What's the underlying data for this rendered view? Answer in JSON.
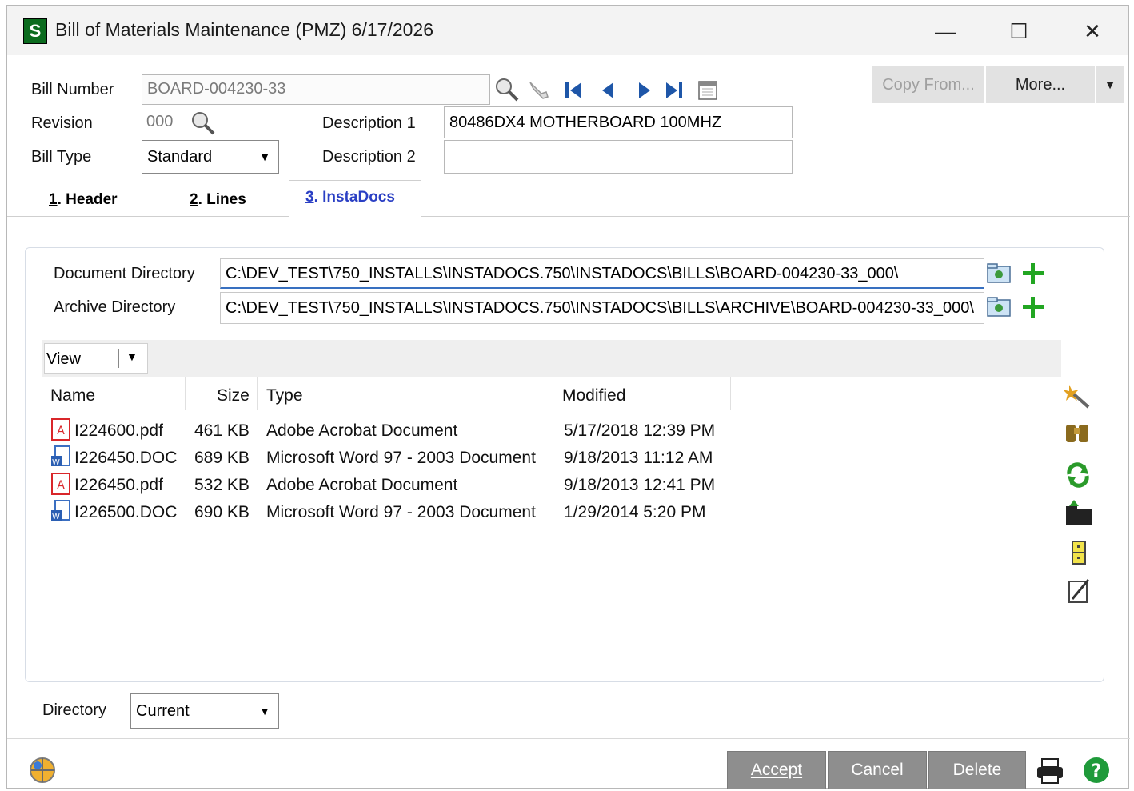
{
  "window": {
    "title": "Bill of Materials Maintenance (PMZ) 6/17/2026",
    "app_icon_letter": "S"
  },
  "header": {
    "bill_number_label": "Bill Number",
    "bill_number_value": "BOARD-004230-33",
    "revision_label": "Revision",
    "revision_value": "000",
    "bill_type_label": "Bill Type",
    "bill_type_value": "Standard",
    "description1_label": "Description 1",
    "description1_value": "80486DX4 MOTHERBOARD 100MHZ",
    "description2_label": "Description 2",
    "description2_value": "",
    "copy_from_label": "Copy From...",
    "more_label": "More..."
  },
  "tabs": [
    {
      "num": "1",
      "label": ". Header"
    },
    {
      "num": "2",
      "label": ". Lines"
    },
    {
      "num": "3",
      "label": ". InstaDocs"
    }
  ],
  "instadocs": {
    "document_directory_label": "Document Directory",
    "document_directory_value": "C:\\DEV_TEST\\750_INSTALLS\\INSTADOCS.750\\INSTADOCS\\BILLS\\BOARD-004230-33_000\\",
    "archive_directory_label": "Archive Directory",
    "archive_directory_value": "C:\\DEV_TEST\\750_INSTALLS\\INSTADOCS.750\\INSTADOCS\\BILLS\\ARCHIVE\\BOARD-004230-33_000\\",
    "view_label": "View",
    "columns": [
      "Name",
      "Size",
      "Type",
      "Modified"
    ],
    "files": [
      {
        "icon": "pdf-icon",
        "name": "I224600.pdf",
        "size": "461 KB",
        "type": "Adobe Acrobat Document",
        "modified": "5/17/2018 12:39 PM"
      },
      {
        "icon": "word-icon",
        "name": "I226450.DOC",
        "size": "689 KB",
        "type": "Microsoft Word 97 - 2003 Document",
        "modified": "9/18/2013 11:12 AM"
      },
      {
        "icon": "pdf-icon",
        "name": "I226450.pdf",
        "size": "532 KB",
        "type": "Adobe Acrobat Document",
        "modified": "9/18/2013 12:41 PM"
      },
      {
        "icon": "word-icon",
        "name": "I226500.DOC",
        "size": "690 KB",
        "type": "Microsoft Word 97 - 2003 Document",
        "modified": "1/29/2014 5:20 PM"
      }
    ],
    "directory_label": "Directory",
    "directory_value": "Current"
  },
  "footer": {
    "accept_label": "Accept",
    "cancel_label": "Cancel",
    "delete_label": "Delete"
  }
}
